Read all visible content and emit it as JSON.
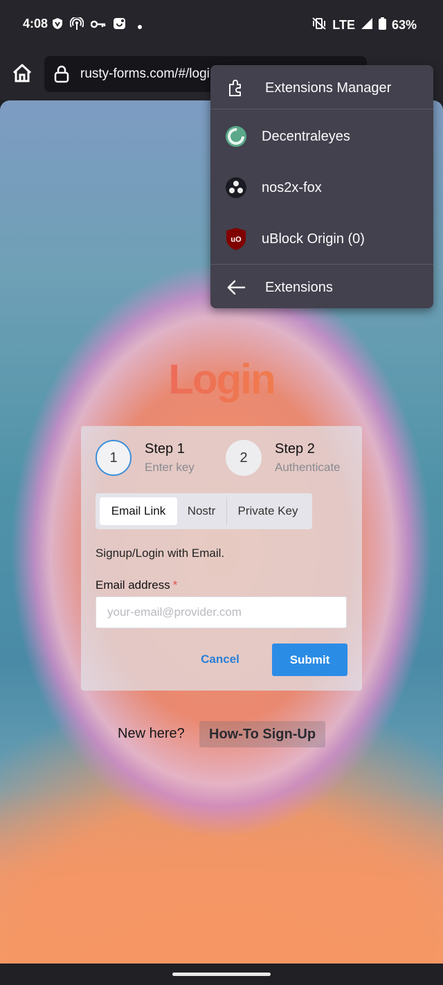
{
  "status_bar": {
    "time": "4:08",
    "network": "LTE",
    "battery": "63%",
    "left_icons": [
      "vpn-shield-icon",
      "hotspot-icon",
      "key-icon",
      "app-notification-icon",
      "dot-icon"
    ],
    "right_icons": [
      "vibrate-off-icon",
      "signal-icon",
      "battery-icon"
    ]
  },
  "browser": {
    "url": "rusty-forms.com/#/login"
  },
  "extensions_menu": {
    "manager_label": "Extensions Manager",
    "items": [
      {
        "label": "Decentraleyes",
        "icon": "decentraleyes-icon"
      },
      {
        "label": "nos2x-fox",
        "icon": "nos2x-fox-icon"
      },
      {
        "label": "uBlock Origin (0)",
        "icon": "ublock-origin-icon"
      }
    ],
    "back_label": "Extensions"
  },
  "page": {
    "title": "Login",
    "steps": [
      {
        "number": "1",
        "title": "Step 1",
        "subtitle": "Enter key"
      },
      {
        "number": "2",
        "title": "Step 2",
        "subtitle": "Authenticate"
      }
    ],
    "tabs": [
      "Email Link",
      "Nostr",
      "Private Key"
    ],
    "selected_tab": "Email Link",
    "intro_text": "Signup/Login with Email.",
    "email_label": "Email address",
    "required_mark": "*",
    "email_placeholder": "your-email@provider.com",
    "email_value": "",
    "cancel_label": "Cancel",
    "submit_label": "Submit",
    "new_here": "New here?",
    "howto_label": "How-To Sign-Up"
  },
  "colors": {
    "accent": "#2b8ce6",
    "menu_bg": "#42414d",
    "chrome_bg": "#25252b"
  }
}
